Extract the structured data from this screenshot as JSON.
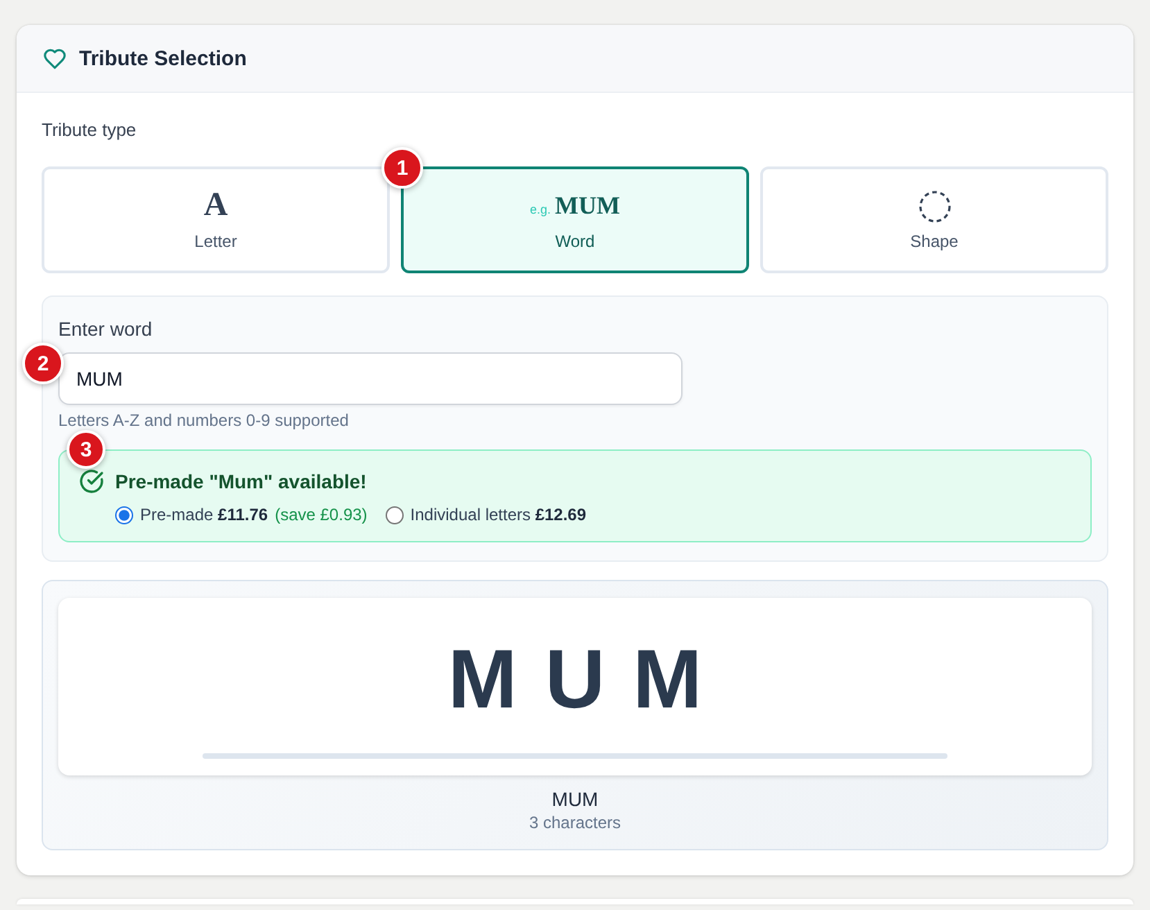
{
  "panel": {
    "title": "Tribute Selection"
  },
  "tribute_type": {
    "label": "Tribute type",
    "options": [
      {
        "kind": "glyph",
        "glyph": "A",
        "label": "Letter",
        "selected": false
      },
      {
        "kind": "sample",
        "prefix": "e.g.",
        "sample": "MUM",
        "label": "Word",
        "selected": true,
        "marker": "1"
      },
      {
        "kind": "icon",
        "label": "Shape",
        "selected": false
      }
    ]
  },
  "word_entry": {
    "label": "Enter word",
    "value": "MUM",
    "marker": "2",
    "hint": "Letters A-Z and numbers 0-9 supported"
  },
  "premade_offer": {
    "heading": "Pre-made \"Mum\" available!",
    "marker": "3",
    "options": [
      {
        "label": "Pre-made **£11.76**",
        "note": "(save £0.93)",
        "selected": true
      },
      {
        "label": "Individual letters **£12.69**",
        "selected": false
      }
    ]
  },
  "preview": {
    "text": "MUM",
    "caption": "MUM",
    "count": "3 characters"
  }
}
